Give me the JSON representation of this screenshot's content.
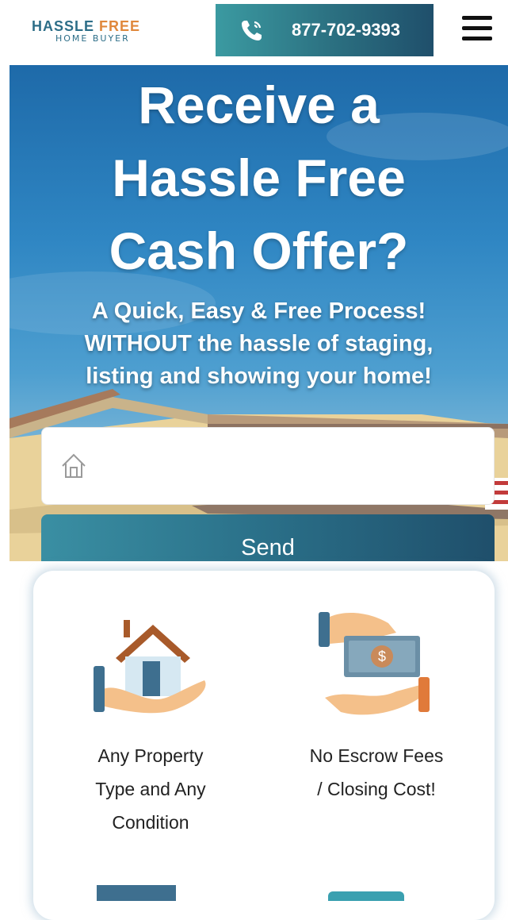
{
  "header": {
    "logo_line1_part1": "HASSLE",
    "logo_line1_part2": "FREE",
    "logo_line2": "HOME BUYER",
    "phone_number": "877-702-9393",
    "menu_icon": "hamburger-menu-icon",
    "phone_icon": "phone-icon"
  },
  "hero": {
    "title_line1": "Receive a",
    "title_line2": "Hassle Free",
    "title_line3": "Cash Offer?",
    "sub_line1": "A Quick, Easy & Free Process!",
    "sub_line2": "WITHOUT the hassle of staging,",
    "sub_line3": "listing and showing your home!",
    "address_input": {
      "value": "",
      "placeholder": "",
      "icon": "home-icon"
    },
    "send_label": "Send"
  },
  "features": {
    "items": [
      {
        "line1": "Any Property",
        "line2": "Type and Any",
        "line3": "Condition",
        "icon": "house-in-hand-icon"
      },
      {
        "line1": "No Escrow Fees",
        "line2": "/ Closing Cost!",
        "icon": "money-exchange-icon"
      }
    ]
  },
  "colors": {
    "brand_teal": "#2d6e88",
    "brand_orange": "#e0883c",
    "button_gradient_start": "#3b9aa1",
    "button_gradient_end": "#1f4f6b",
    "sky_blue": "#2f86c3"
  }
}
